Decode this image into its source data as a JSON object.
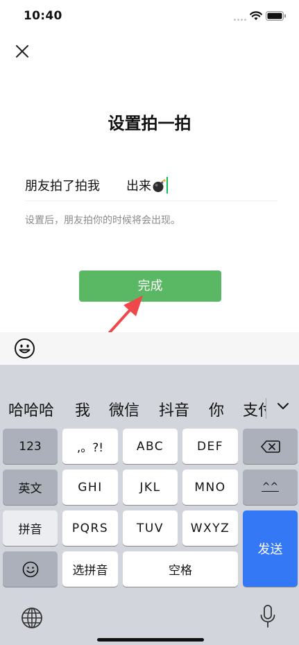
{
  "status_bar": {
    "time": "10:40"
  },
  "page": {
    "title": "设置拍一拍",
    "field_label": "朋友拍了拍我",
    "field_value": "出来",
    "hint": "设置后，朋友拍你的时候将会出现。",
    "done_label": "完成"
  },
  "keyboard": {
    "candidates": [
      "哈哈哈",
      "我",
      "微信",
      "抖音",
      "你",
      "支付"
    ],
    "keys": {
      "k123": "123",
      "punct": ",。?!",
      "abc": "ABC",
      "def": "DEF",
      "english": "英文",
      "ghi": "GHI",
      "jkl": "JKL",
      "mno": "MNO",
      "caret": "^^",
      "pinyin": "拼音",
      "pqrs": "PQRS",
      "tuv": "TUV",
      "wxyz": "WXYZ",
      "send": "发送",
      "select_pinyin": "选拼音",
      "space": "空格"
    }
  },
  "colors": {
    "accent_green": "#5ab764",
    "send_blue": "#3478f6",
    "arrow_red": "#f0474a",
    "keyboard_bg": "#d2d5db"
  },
  "icons": [
    "close-icon",
    "bomb-icon",
    "emoji-icon",
    "chevron-down-icon",
    "backspace-icon",
    "globe-icon",
    "microphone-icon",
    "wifi-icon",
    "battery-icon"
  ]
}
